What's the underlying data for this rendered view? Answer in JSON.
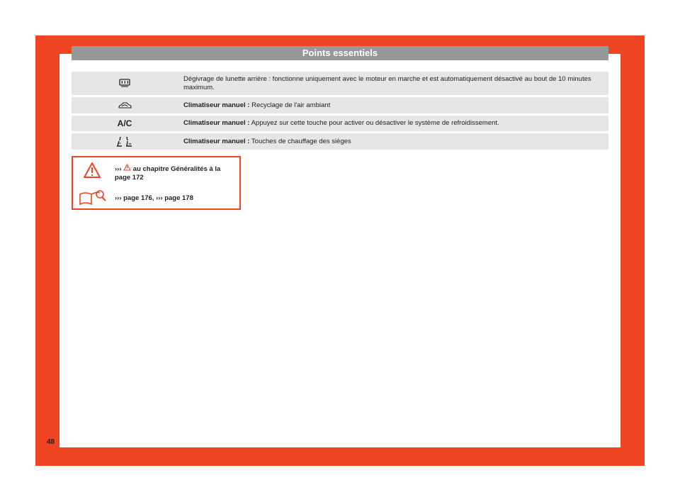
{
  "header": {
    "title": "Points essentiels"
  },
  "rows": [
    {
      "icon": "rear-window-defrost-icon",
      "label": "",
      "text": "Dégivrage de lunette arrière : fonctionne uniquement avec le moteur en marche et est automatiquement désactivé au bout de 10 minutes maximum."
    },
    {
      "icon": "air-recirculation-icon",
      "label": "Climatiseur manuel :",
      "text": "Recyclage de l'air ambiant"
    },
    {
      "icon": "ac-icon",
      "icon_text": "A/C",
      "label": "Climatiseur manuel :",
      "text": "Appuyez sur cette touche pour activer ou désactiver le système de refroidissement."
    },
    {
      "icon": "seat-heating-icon",
      "label": "Climatiseur manuel :",
      "text": "Touches de chauffage des sièges"
    }
  ],
  "note": {
    "line1_prefix": "›››",
    "line1_text": "au chapitre Généralités à la page 172",
    "line2": "››› page 176, ››› page 178"
  },
  "page_number": "48",
  "colors": {
    "accent": "#f04523",
    "header_bar": "#95999a",
    "row_bg": "#e6e6e6"
  }
}
